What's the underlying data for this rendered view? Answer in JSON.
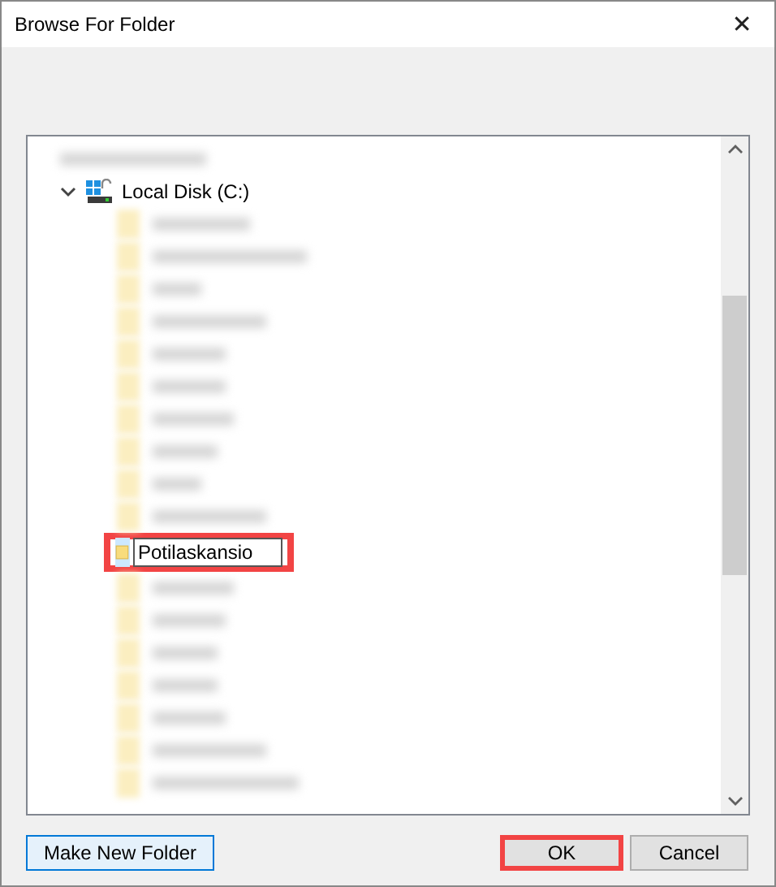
{
  "window": {
    "title": "Browse For Folder",
    "close": "✕"
  },
  "tree": {
    "drive": {
      "label": "Local Disk (C:)",
      "expanded": true
    },
    "new_folder": {
      "value": "Potilaskansio",
      "highlighted": true
    }
  },
  "buttons": [
    {
      "label": "Make New Folder",
      "kind": "secondary",
      "highlighted": false
    },
    {
      "label": "OK",
      "kind": "default",
      "highlighted": true
    },
    {
      "label": "Cancel",
      "kind": "secondary",
      "highlighted": false
    }
  ]
}
